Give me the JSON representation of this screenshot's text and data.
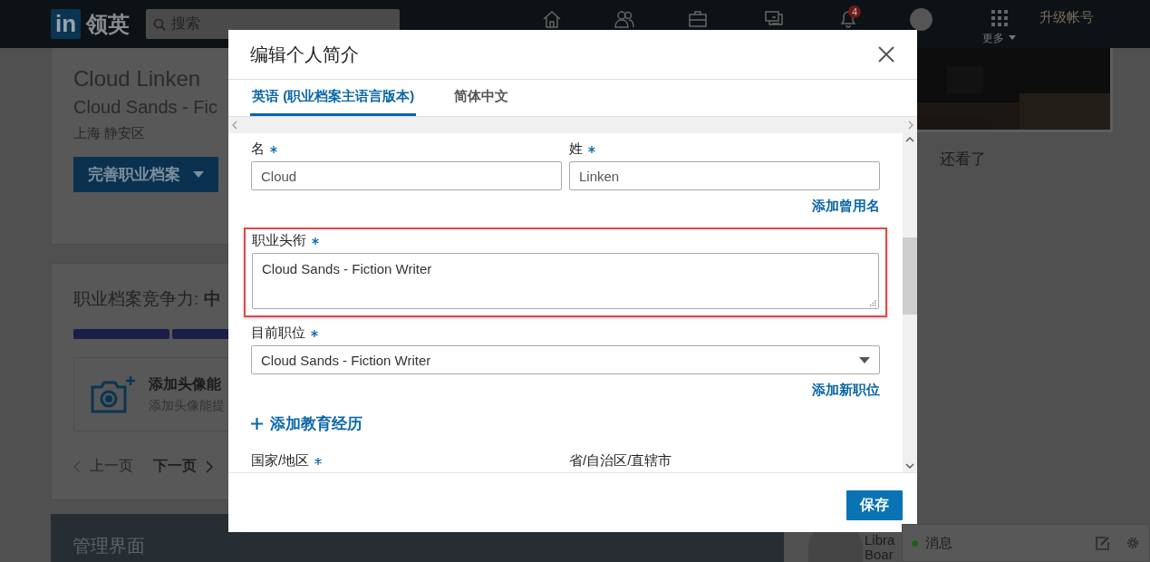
{
  "nav": {
    "logo": "in",
    "brand": "领英",
    "search": {
      "placeholder": "搜索"
    },
    "notification_count": "4",
    "more": "更多",
    "upgrade": "升级帐号"
  },
  "profile": {
    "name": "Cloud Linken",
    "headline": "Cloud Sands - Fic",
    "location": "上海 静安区",
    "button": "完善职业档案"
  },
  "strength": {
    "title": "职业档案竞争力: **中**",
    "tip_title": "添加头像能",
    "tip_text": "添加头像能提",
    "prev": "上一页",
    "next": "下一页"
  },
  "admin": {
    "title": "管理界面"
  },
  "sidebar": {
    "heading": "还看了",
    "card_lines": [
      "Libra",
      "Boar"
    ]
  },
  "messaging": {
    "label": "消息",
    "online": true
  },
  "modal": {
    "title": "编辑个人简介",
    "tabs": [
      {
        "label": "英语 (职业档案主语言版本)",
        "selected": true
      },
      {
        "label": "简体中文",
        "selected": false
      }
    ],
    "first_name": {
      "label": "名",
      "required": true,
      "value": "Cloud"
    },
    "last_name": {
      "label": "姓",
      "required": true,
      "value": "Linken"
    },
    "add_former_name": "添加曾用名",
    "headline": {
      "label": "职业头衔",
      "required": true,
      "value": "Cloud Sands - Fiction Writer",
      "highlighted": true
    },
    "position": {
      "label": "目前职位",
      "required": true,
      "value": "Cloud Sands - Fiction Writer"
    },
    "add_position": "添加新职位",
    "add_education": "添加教育经历",
    "country": {
      "label": "国家/地区",
      "required": true
    },
    "province": {
      "label": "省/自治区/直辖市",
      "required": false
    },
    "save": "保存"
  }
}
